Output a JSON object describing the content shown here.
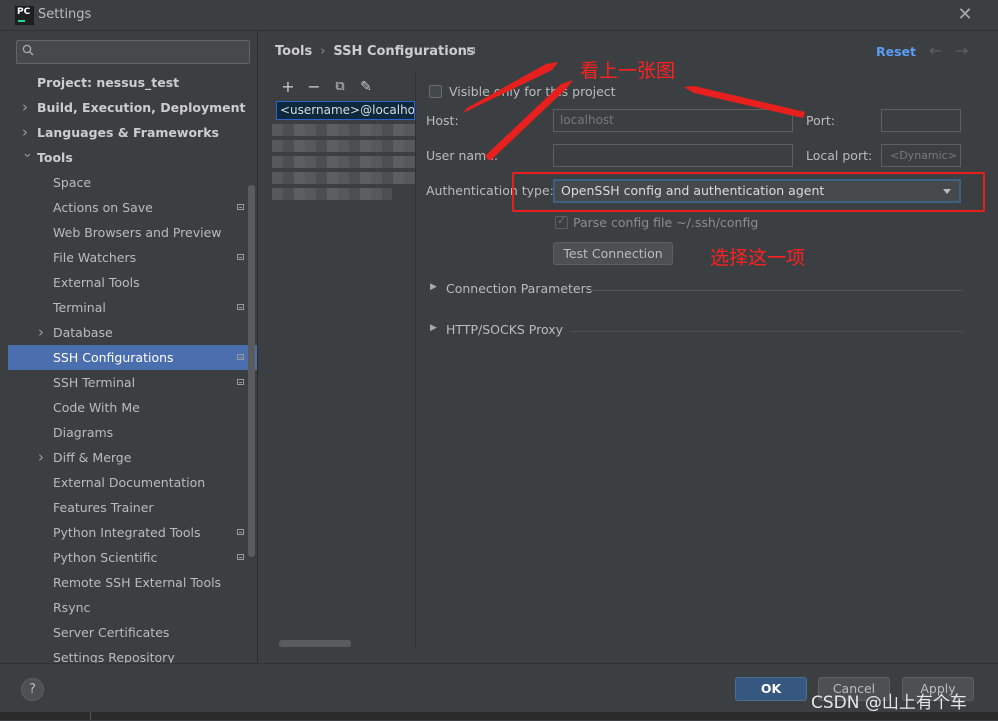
{
  "window": {
    "title": "Settings",
    "logo_text": "PC",
    "close_glyph": "✕"
  },
  "colors": {
    "accent": "#4b6eaf",
    "link": "#589df6",
    "annotation": "#ff2020",
    "background": "#3c3f41"
  },
  "search": {
    "placeholder": "",
    "icon": "search-icon"
  },
  "sidebar": {
    "items": [
      {
        "label": "Project: nessus_test",
        "bold": true,
        "arrow": ""
      },
      {
        "label": "Build, Execution, Deployment",
        "bold": true,
        "arrow": "›"
      },
      {
        "label": "Languages & Frameworks",
        "bold": true,
        "arrow": "›"
      },
      {
        "label": "Tools",
        "bold": true,
        "arrow": "⌄"
      },
      {
        "label": "Space"
      },
      {
        "label": "Actions on Save",
        "mark": true
      },
      {
        "label": "Web Browsers and Preview"
      },
      {
        "label": "File Watchers",
        "mark": true
      },
      {
        "label": "External Tools"
      },
      {
        "label": "Terminal",
        "mark": true
      },
      {
        "label": "Database",
        "arrow": "›"
      },
      {
        "label": "SSH Configurations",
        "mark": true,
        "selected": true
      },
      {
        "label": "SSH Terminal",
        "mark": true
      },
      {
        "label": "Code With Me"
      },
      {
        "label": "Diagrams"
      },
      {
        "label": "Diff & Merge",
        "arrow": "›"
      },
      {
        "label": "External Documentation"
      },
      {
        "label": "Features Trainer"
      },
      {
        "label": "Python Integrated Tools",
        "mark": true
      },
      {
        "label": "Python Scientific",
        "mark": true
      },
      {
        "label": "Remote SSH External Tools"
      },
      {
        "label": "Rsync"
      },
      {
        "label": "Server Certificates"
      },
      {
        "label": "Settings Repository"
      }
    ]
  },
  "header": {
    "breadcrumb_parent": "Tools",
    "breadcrumb_separator": "›",
    "breadcrumb_current": "SSH Configurations",
    "reset": "Reset",
    "back_glyph": "←",
    "forward_glyph": "→"
  },
  "list": {
    "toolbar": {
      "add": "+",
      "remove": "−",
      "copy": "⧉",
      "edit": "✎"
    },
    "entry": "<username>@localhost"
  },
  "form": {
    "visible_only_label": "Visible only for this project",
    "visible_only_checked": false,
    "host_label": "Host:",
    "host_placeholder": "localhost",
    "port_label": "Port:",
    "port_value": "",
    "user_label": "User name:",
    "user_value": "",
    "local_port_label": "Local port:",
    "local_port_placeholder": "<Dynamic>",
    "auth_label": "Authentication type:",
    "auth_value": "OpenSSH config and authentication agent",
    "parse_label": "Parse config file ~/.ssh/config",
    "parse_checked": true,
    "test_button": "Test Connection",
    "sections": [
      {
        "label": "Connection Parameters",
        "expanded": false
      },
      {
        "label": "HTTP/SOCKS Proxy",
        "expanded": false
      }
    ]
  },
  "footer": {
    "help": "?",
    "ok": "OK",
    "cancel": "Cancel",
    "apply": "Apply"
  },
  "annotations": {
    "see_previous": "看上一张图",
    "choose_this": "选择这一项"
  },
  "watermark": "CSDN @山上有个车"
}
